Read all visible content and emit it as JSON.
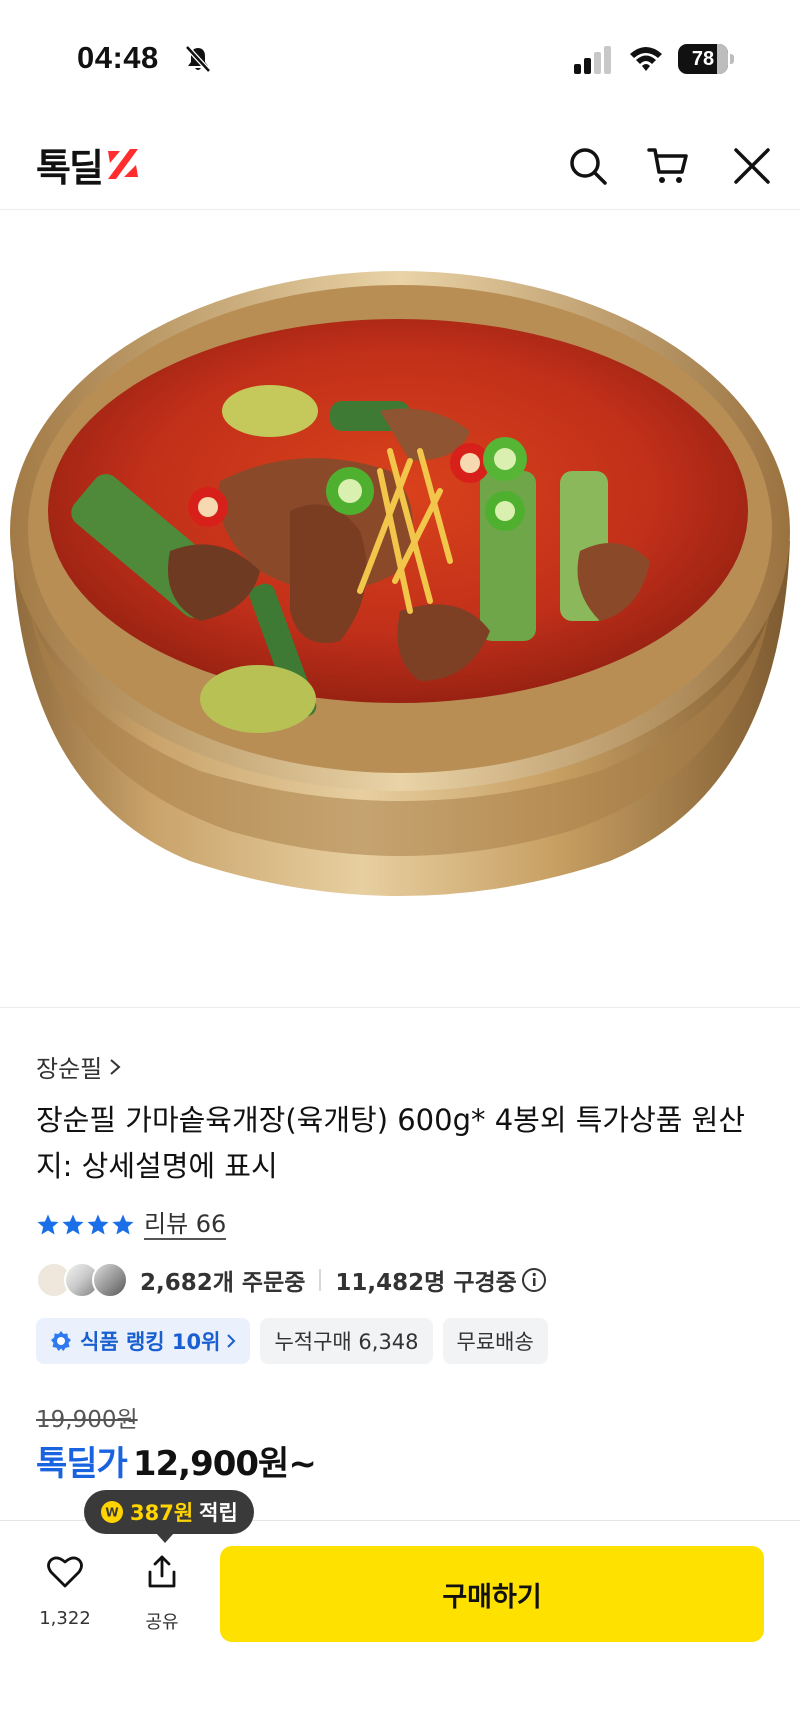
{
  "status_bar": {
    "time": "04:48",
    "battery": "78",
    "battery_level": 0.78
  },
  "header": {
    "logo_text": "톡딜",
    "icons": [
      "search-icon",
      "cart-icon",
      "close-icon"
    ]
  },
  "product": {
    "image": "food-bowl-image",
    "brand": "장순필",
    "title": "장순필 가마솥육개장(육개탕) 600g* 4봉외 특가상품 원산지: 상세설명에 표시",
    "rating_stars": 4,
    "review_label": "리뷰 66",
    "orders": "2,682개 주문중",
    "viewers": "11,482명 구경중",
    "tags": {
      "rank": "식품 랭킹 10위",
      "cumulative": "누적구매 6,348",
      "shipping": "무료배송"
    },
    "original_price": "19,900원",
    "deal_label": "톡딜가",
    "deal_price": "12,900원~"
  },
  "bottom_bar": {
    "point_amount": "387원",
    "point_label": "적립",
    "like_count": "1,322",
    "share_label": "공유",
    "buy_label": "구매하기"
  },
  "colors": {
    "accent_blue": "#1a63e0",
    "logo_red": "#ff2d2d",
    "buy_yellow": "#ffe100",
    "point_yellow": "#ffd400",
    "star_blue": "#1a6fe8"
  }
}
